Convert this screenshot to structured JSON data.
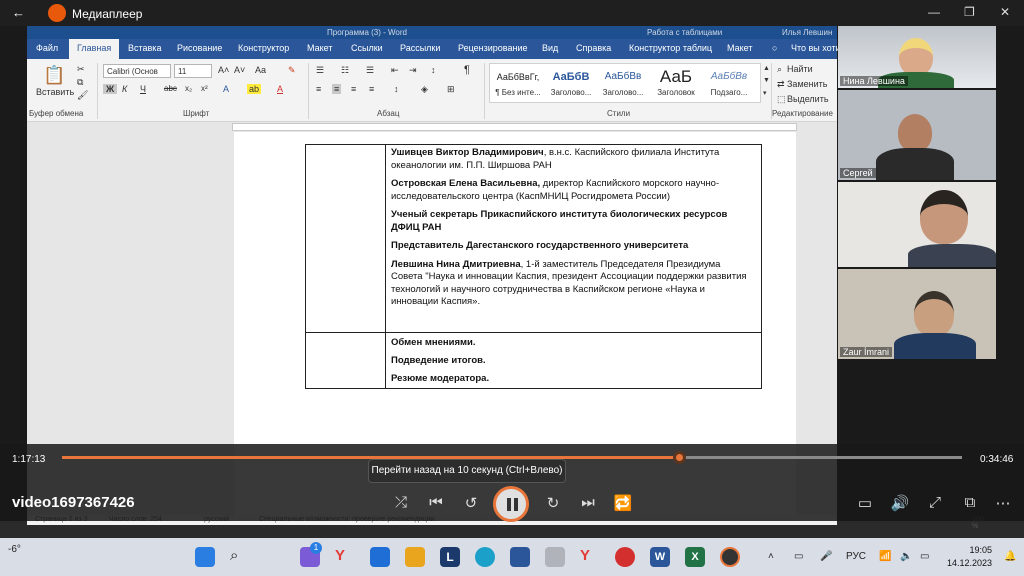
{
  "titlebar": {
    "title": "Медиаплеер",
    "back": "←",
    "minimize": "—",
    "maximize": "❐",
    "close": "✕"
  },
  "word": {
    "top_title": "Программа (3) - Word",
    "top_table_tools": "Работа с таблицами",
    "top_user": "Илья Левшин",
    "tabs": [
      "Файл",
      "Главная",
      "Вставка",
      "Рисование",
      "Конструктор",
      "Макет",
      "Ссылки",
      "Рассылки",
      "Рецензирование",
      "Вид",
      "Справка",
      "Конструктор таблиц",
      "Макет"
    ],
    "active_tab": "Главная",
    "tell_me": "Что вы хоти",
    "clipboard": {
      "paste": "Вставить",
      "label": "Буфер обмена"
    },
    "font": {
      "name": "Calibri (Основ",
      "size": "11",
      "label": "Шрифт",
      "bold": "Ж",
      "italic": "К",
      "underline": "Ч"
    },
    "paragraph": {
      "label": "Абзац"
    },
    "styles": {
      "label": "Стили",
      "items": [
        {
          "sample": "АаБбВвГг,",
          "name": "¶ Без инте..."
        },
        {
          "sample": "АаБбВ",
          "name": "Заголово..."
        },
        {
          "sample": "АаБбВв",
          "name": "Заголово..."
        },
        {
          "sample": "АаБ",
          "name": "Заголовок"
        },
        {
          "sample": "АаБбВв",
          "name": "Подзаго..."
        }
      ]
    },
    "editing": {
      "label": "Редактирование",
      "find": "Найти",
      "replace": "Заменить",
      "select": "Выделить"
    },
    "document": {
      "rows": [
        {
          "html": "<p><b>Ушивцев Виктор Владимирович</b>, в.н.с. Каспийского филиала Института океанологии им. П.П. Ширшова РАН</p><p><b>Островская Елена Васильевна,</b> директор Каспийского морского научно-исследовательского центра (КаспМНИЦ Росгидромета России)</p><p><b>Ученый секретарь Прикаспийского института биологических ресурсов ДФИЦ РАН</b></p><p><b>Представитель Дагестанского государственного университета</b></p><p><b>Левшина Нина Дмитриевна</b>, 1-й заместитель Председателя Президиума Совета \"Наука и инновации Каспия, президент Ассоциации поддержки развития технологий и научного сотрудничества в Каспийском регионе «Наука и инновации Каспия».</p>"
        }
      ],
      "closing": [
        "Обмен мнениями.",
        "Подведение итогов.",
        "Резюме модератора."
      ]
    },
    "status": {
      "page": "Страница 2 из 3",
      "words": "Число слов: 254",
      "lang": "русский",
      "accessibility": "Специальные возможности: проверьте рекомендации",
      "zoom": "100 %"
    }
  },
  "participants": [
    {
      "name": "Нина Левшина"
    },
    {
      "name": "Сергей"
    },
    {
      "name": ""
    },
    {
      "name": "Zaur İmrani"
    }
  ],
  "player": {
    "current_time": "1:17:13",
    "remaining_time": "0:34:46",
    "progress": 0.685,
    "tooltip": "Перейти назад на 10 секунд (Ctrl+Влево)",
    "video_title": "video1697367426"
  },
  "taskbar": {
    "weather": "-6°",
    "lang": "РУС",
    "time": "19:05",
    "date": "14.12.2023",
    "badge": "1"
  },
  "colors": {
    "accent": "#e8763a",
    "word_blue": "#2b579a"
  }
}
